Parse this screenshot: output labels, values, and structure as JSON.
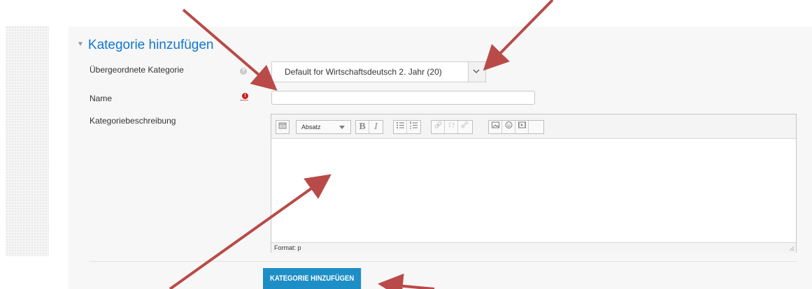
{
  "form": {
    "section_title": "Kategorie hinzufügen",
    "parent_category_label": "Übergeordnete Kategorie",
    "parent_category_value": "Default for Wirtschaftsdeutsch 2. Jahr (20)",
    "name_label": "Name",
    "name_value": "",
    "description_label": "Kategoriebeschreibung",
    "submit_label": "KATEGORIE HINZUFÜGEN"
  },
  "editor": {
    "format_value": "Absatz",
    "bold": "B",
    "italic": "I",
    "status": "Format: p"
  },
  "icons": {
    "collapse": "triangle-down-icon",
    "help": "question-icon",
    "required": "exclamation-icon",
    "select": "chevron-down-icon",
    "toolbar": [
      "toolbar-toggle-icon",
      "bulleted-list-icon",
      "numbered-list-icon",
      "link-icon",
      "unlink-icon",
      "anchor-icon",
      "image-icon",
      "emoticon-icon",
      "media-icon"
    ]
  },
  "colors": {
    "accent": "#1177d1",
    "button": "#1d8ec6",
    "annotation_arrow": "#b84b49",
    "required": "#c81d1d"
  }
}
